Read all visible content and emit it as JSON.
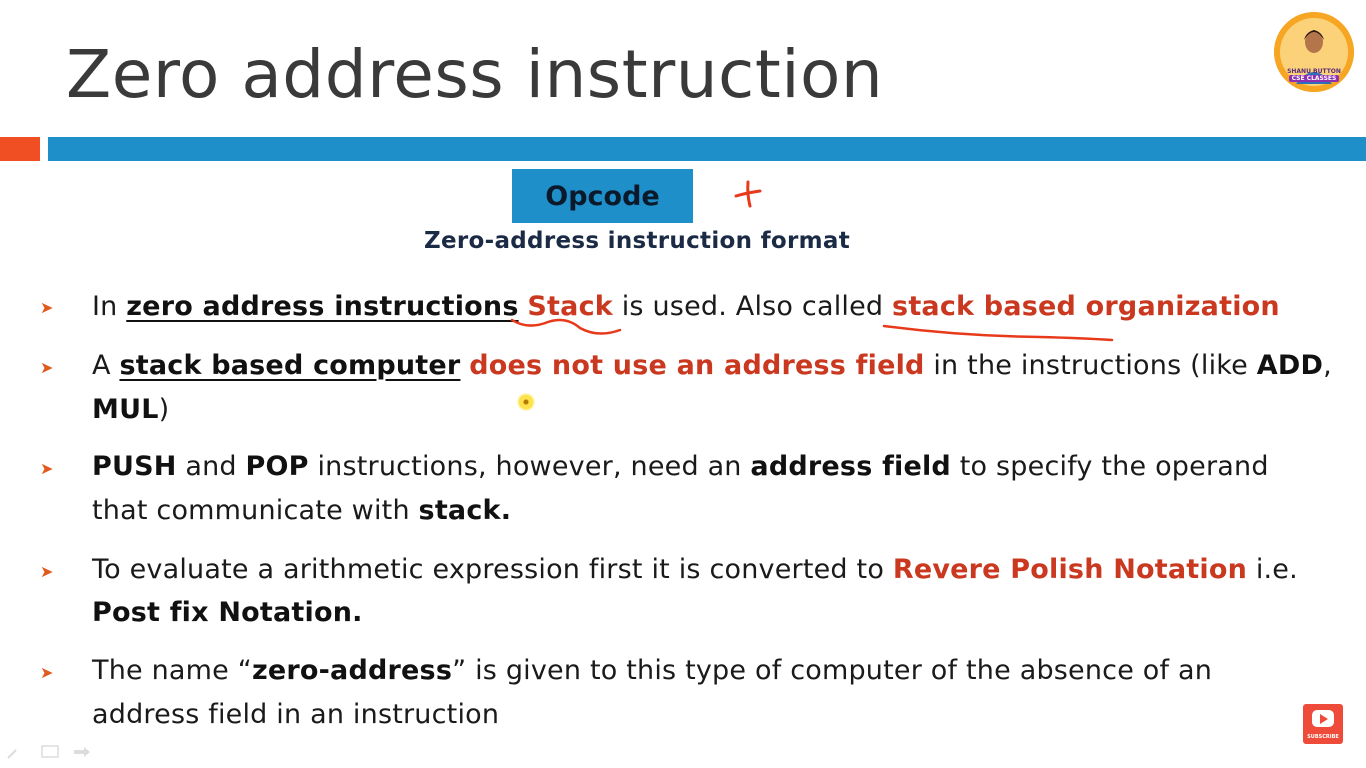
{
  "slide": {
    "title": "Zero address instruction",
    "opcode_label": "Opcode",
    "format_caption": "Zero-address instruction format",
    "avatar": {
      "brand": "SHANU BUTTON",
      "classes": "CSE CLASSES"
    },
    "subscribe_label": "SUBSCRIBE",
    "colors": {
      "title": "#3a3a3a",
      "accent_bar": "#f04e23",
      "main_bar": "#1e8fc9",
      "highlight_red": "#c9381f",
      "bullet_arrow": "#e05a1e",
      "ink_annotation": "#e8391a"
    },
    "icons": {
      "bullet": "arrow-bullet-icon",
      "annotation": "cross-mark-icon",
      "subscribe": "youtube-subscribe-icon",
      "pointer": "laser-pointer-icon"
    }
  },
  "bullets": [
    {
      "p1": "In ",
      "p2": "zero address instructions",
      "p3": " ",
      "p4": "Stack",
      "p5": " is used. Also called ",
      "p6": "stack based organization"
    },
    {
      "p1": "A ",
      "p2": "stack based computer",
      "p3": " ",
      "p4": "does not use an address field",
      "p5": " in the instructions (like ",
      "p6": "ADD",
      "p7": ",",
      "line2_bold": "MUL",
      "line2_rest": ")"
    },
    {
      "p1": "PUSH",
      "p2": " and ",
      "p3": "POP",
      "p4": " instructions, however, need an ",
      "p5": "address field",
      "p6": " to specify the operand",
      "line2_rest": "that  communicate with ",
      "line2_bold": "stack."
    },
    {
      "p1": "To evaluate a arithmetic expression first it is converted to ",
      "p2": "Revere Polish Notation",
      "p3": " i.e.",
      "line2_bold": "Post fix Notation."
    },
    {
      "p1": "The name “",
      "p2": "zero-address",
      "p3": "” is given to this type of computer of the absence of an",
      "line2_rest": "address field in an instruction"
    }
  ]
}
